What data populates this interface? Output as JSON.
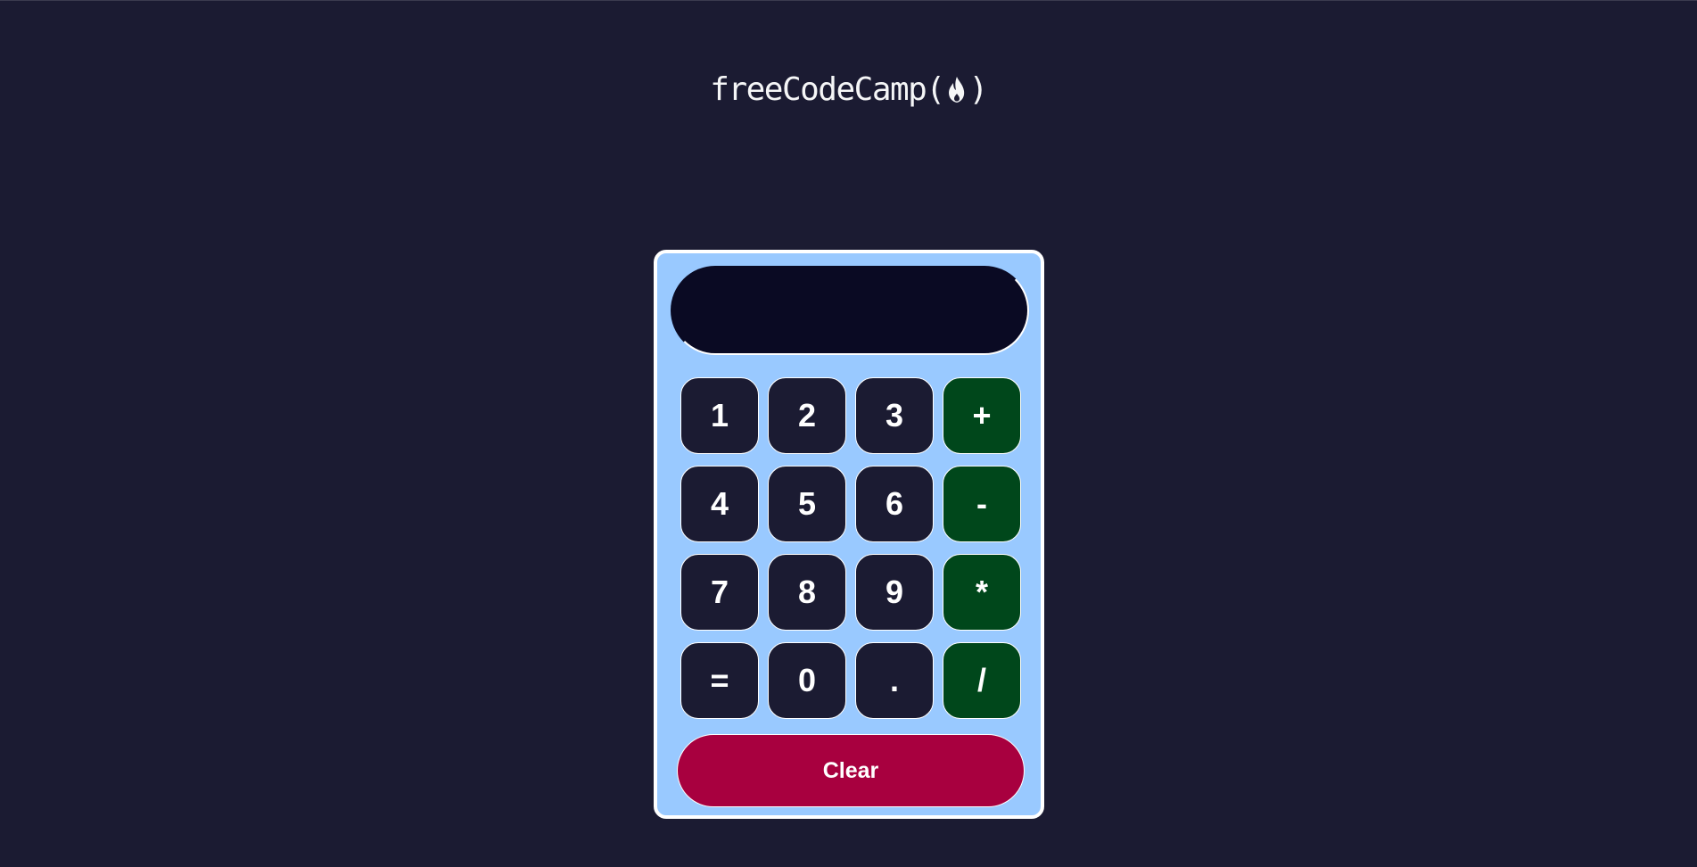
{
  "header": {
    "logo_text_before": "freeCodeCamp(",
    "logo_text_after": ")",
    "logo_icon": "fire-icon"
  },
  "calculator": {
    "display_value": "",
    "keys": [
      {
        "label": "1",
        "kind": "digit"
      },
      {
        "label": "2",
        "kind": "digit"
      },
      {
        "label": "3",
        "kind": "digit"
      },
      {
        "label": "+",
        "kind": "operator"
      },
      {
        "label": "4",
        "kind": "digit"
      },
      {
        "label": "5",
        "kind": "digit"
      },
      {
        "label": "6",
        "kind": "digit"
      },
      {
        "label": "-",
        "kind": "operator"
      },
      {
        "label": "7",
        "kind": "digit"
      },
      {
        "label": "8",
        "kind": "digit"
      },
      {
        "label": "9",
        "kind": "digit"
      },
      {
        "label": "*",
        "kind": "operator"
      },
      {
        "label": "=",
        "kind": "digit"
      },
      {
        "label": "0",
        "kind": "digit"
      },
      {
        "label": ".",
        "kind": "digit"
      },
      {
        "label": "/",
        "kind": "operator"
      }
    ],
    "clear_label": "Clear"
  },
  "colors": {
    "page_background": "#1b1b32",
    "calculator_body": "#99c9ff",
    "display_background": "#0a0a23",
    "digit_key": "#1b1b32",
    "operator_key": "#00471b",
    "clear_button": "#a8003f",
    "text": "#ffffff"
  }
}
